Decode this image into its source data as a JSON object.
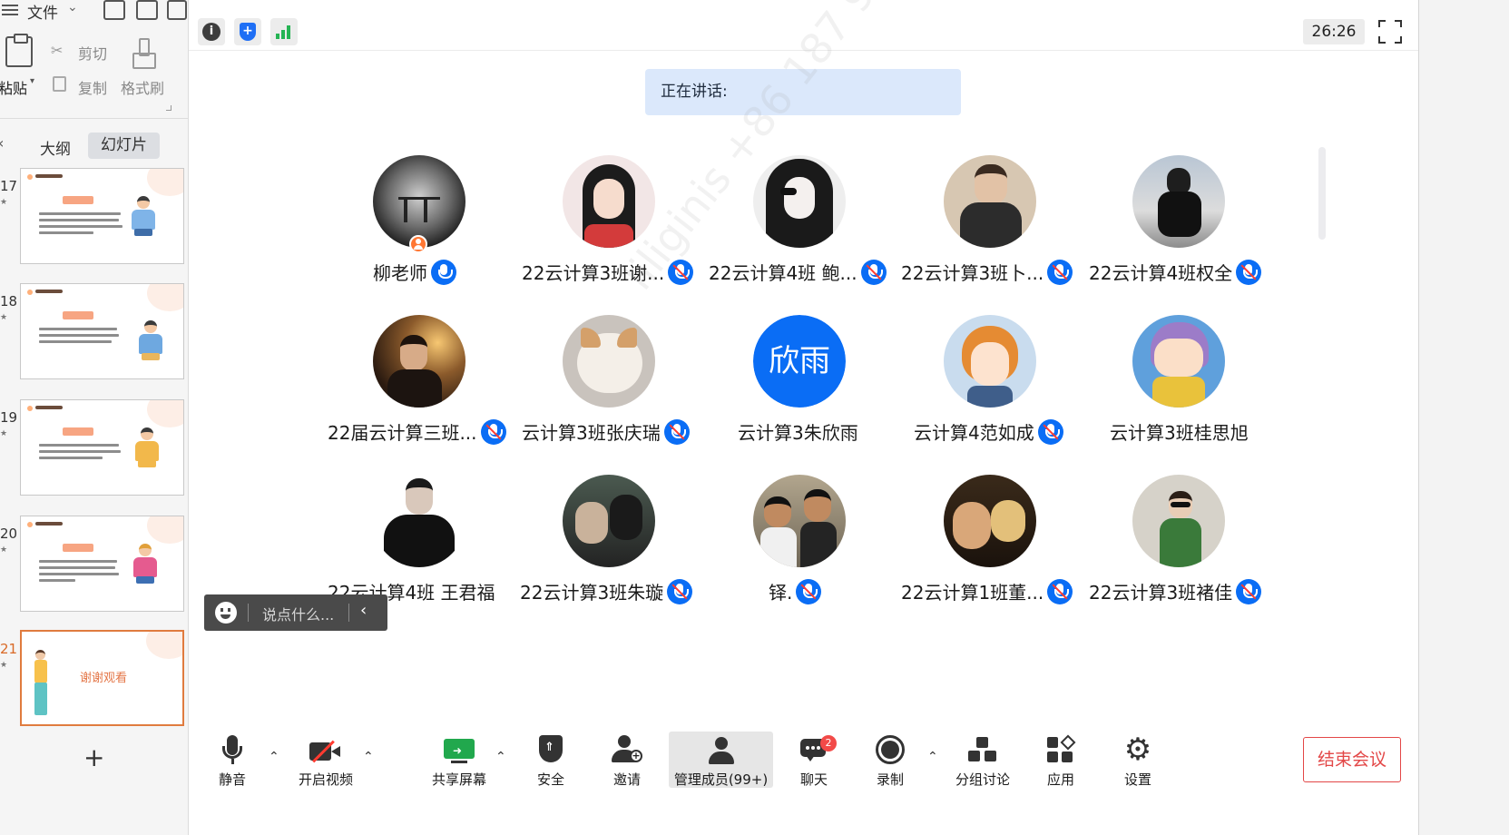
{
  "ppt": {
    "file_label": "文件",
    "paste_label": "粘贴",
    "cut_label": "剪切",
    "copy_label": "复制",
    "format_brush_label": "格式刷",
    "tab_outline": "大纲",
    "tab_slides": "幻灯片",
    "slides": [
      {
        "num": "17"
      },
      {
        "num": "18"
      },
      {
        "num": "19"
      },
      {
        "num": "20"
      },
      {
        "num": "21",
        "thanks": "谢谢观看"
      }
    ]
  },
  "meeting": {
    "timer": "26:26",
    "speaking_label": "正在讲话:",
    "watermark": "liliginis +86 187 960125",
    "participants": [
      {
        "name": "柳老师",
        "mic": "on",
        "host": true
      },
      {
        "name": "22云计算3班谢...",
        "mic": "muted"
      },
      {
        "name": "22云计算4班 鲍...",
        "mic": "muted"
      },
      {
        "name": "22云计算3班卜...",
        "mic": "muted"
      },
      {
        "name": "22云计算4班权全",
        "mic": "muted"
      },
      {
        "name": "22届云计算三班...",
        "mic": "muted"
      },
      {
        "name": "云计算3班张庆瑞",
        "mic": "muted"
      },
      {
        "name": "云计算3朱欣雨",
        "mic": "none",
        "avatar_text": "欣雨"
      },
      {
        "name": "云计算4范如成",
        "mic": "muted"
      },
      {
        "name": "云计算3班桂思旭",
        "mic": "none"
      },
      {
        "name": "22云计算4班 王君福",
        "mic": "none"
      },
      {
        "name": "22云计算3班朱璇",
        "mic": "muted"
      },
      {
        "name": "铎.",
        "mic": "muted"
      },
      {
        "name": "22云计算1班董...",
        "mic": "muted"
      },
      {
        "name": "22云计算3班褚佳",
        "mic": "muted"
      }
    ],
    "chat_placeholder": "说点什么...",
    "toolbar": {
      "mute": "静音",
      "video": "开启视频",
      "share": "共享屏幕",
      "security": "安全",
      "invite": "邀请",
      "members": "管理成员(99+)",
      "chat": "聊天",
      "chat_badge": "2",
      "record": "录制",
      "breakout": "分组讨论",
      "apps": "应用",
      "settings": "设置",
      "end": "结束会议"
    }
  },
  "colors": {
    "accent_blue": "#0a6df5",
    "end_red": "#e34747",
    "signal_green": "#25b454"
  }
}
